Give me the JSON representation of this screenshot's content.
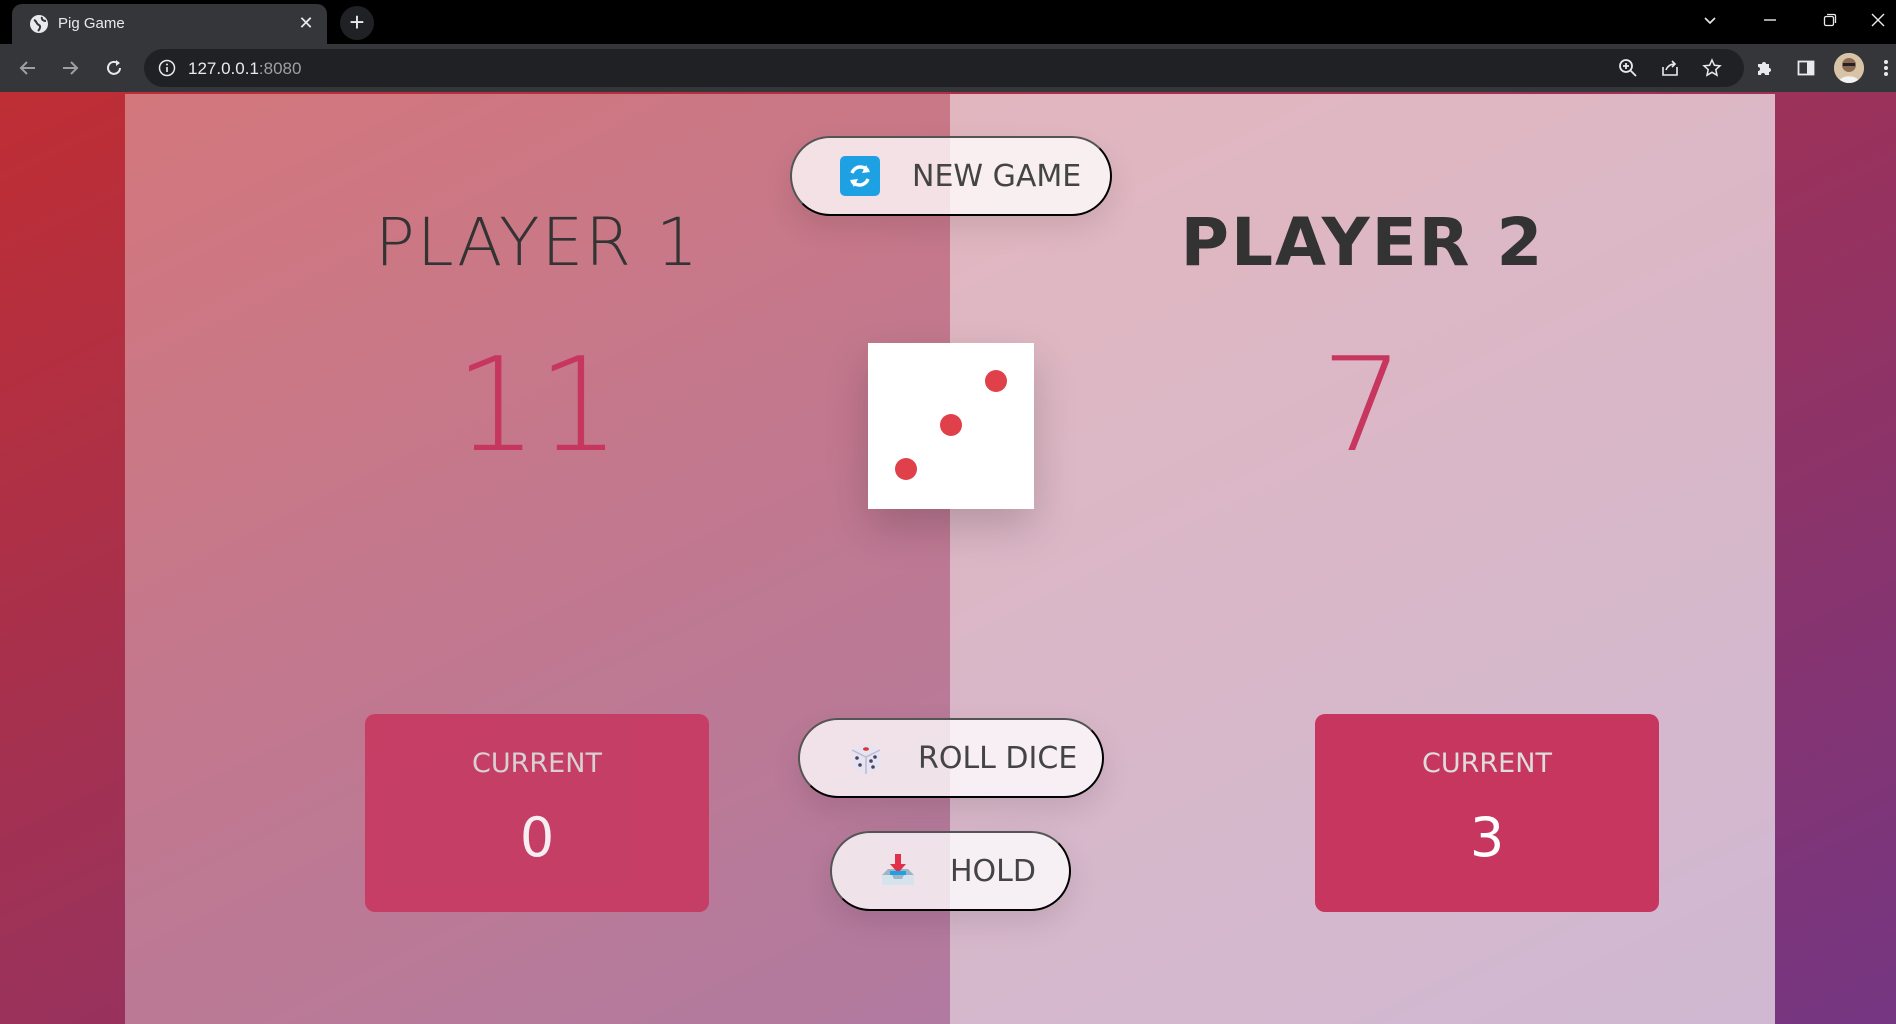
{
  "browser": {
    "tab_title": "Pig Game",
    "url_host": "127.0.0.1",
    "url_port": ":8080",
    "icons": [
      "globe-icon",
      "close-icon",
      "plus-icon",
      "chevron-down-icon",
      "minimize-icon",
      "restore-icon",
      "back-icon",
      "forward-icon",
      "reload-icon",
      "info-icon",
      "zoom-icon",
      "share-icon",
      "star-icon",
      "extensions-icon",
      "sidepanel-icon",
      "avatar",
      "menu-icon"
    ]
  },
  "game": {
    "players": [
      {
        "name": "PLAYER 1",
        "score": "11",
        "current_label": "CURRENT",
        "current_score": "0",
        "active": false
      },
      {
        "name": "PLAYER 2",
        "score": "7",
        "current_label": "CURRENT",
        "current_score": "3",
        "active": true
      }
    ],
    "buttons": {
      "new_game": "NEW GAME",
      "roll_dice": "ROLL DICE",
      "hold": "HOLD"
    },
    "dice_value": 3,
    "colors": {
      "accent": "#c7365f",
      "dice_pip": "#e0404a",
      "gradient_start": "#bf2e34",
      "gradient_end": "#753682"
    }
  }
}
